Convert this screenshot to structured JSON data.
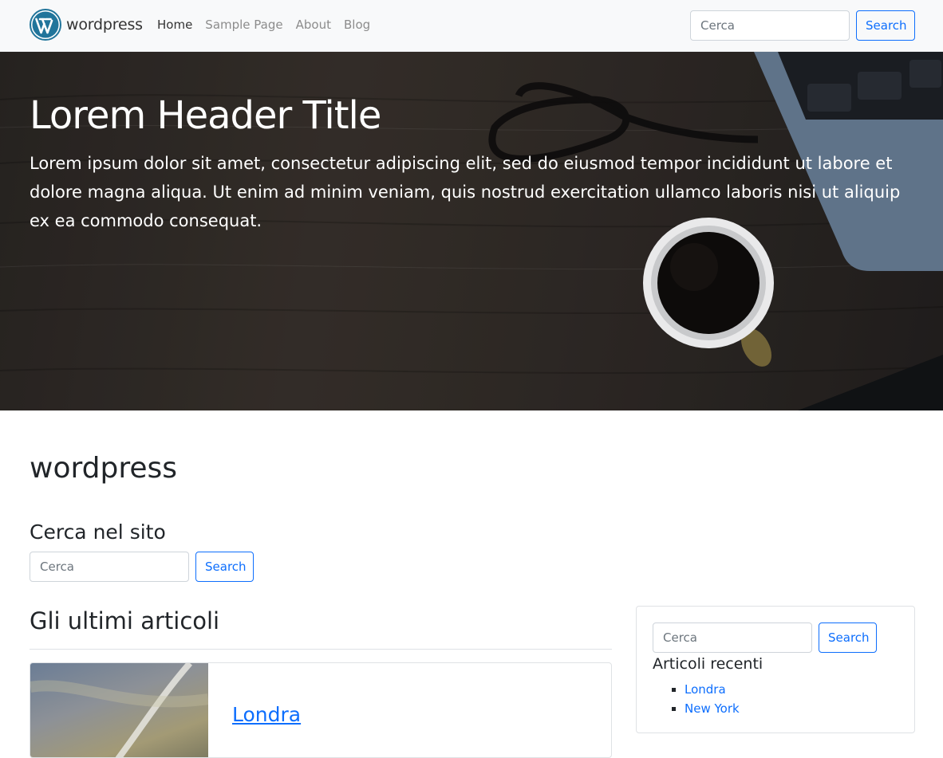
{
  "navbar": {
    "brand": "wordpress",
    "links": [
      {
        "label": "Home"
      },
      {
        "label": "Sample Page"
      },
      {
        "label": "About"
      },
      {
        "label": "Blog"
      }
    ],
    "search_placeholder": "Cerca",
    "search_button": "Search"
  },
  "hero": {
    "title": "Lorem Header Title",
    "text": "Lorem ipsum dolor sit amet, consectetur adipiscing elit, sed do eiusmod tempor incididunt ut labore et dolore magna aliqua. Ut enim ad minim veniam, quis nostrud exercitation ullamco laboris nisi ut aliquip ex ea commodo consequat."
  },
  "main": {
    "site_title": "wordpress",
    "search_heading": "Cerca nel sito",
    "search_placeholder": "Cerca",
    "search_button": "Search",
    "latest_heading": "Gli ultimi articoli",
    "posts": [
      {
        "title": "Londra"
      }
    ]
  },
  "sidebar": {
    "search_placeholder": "Cerca",
    "search_button": "Search",
    "recent_heading": "Articoli recenti",
    "recent_posts": [
      {
        "label": "Londra"
      },
      {
        "label": "New York"
      }
    ]
  },
  "colors": {
    "accent": "#0d6efd",
    "navbar_bg": "#f8f9fa"
  }
}
